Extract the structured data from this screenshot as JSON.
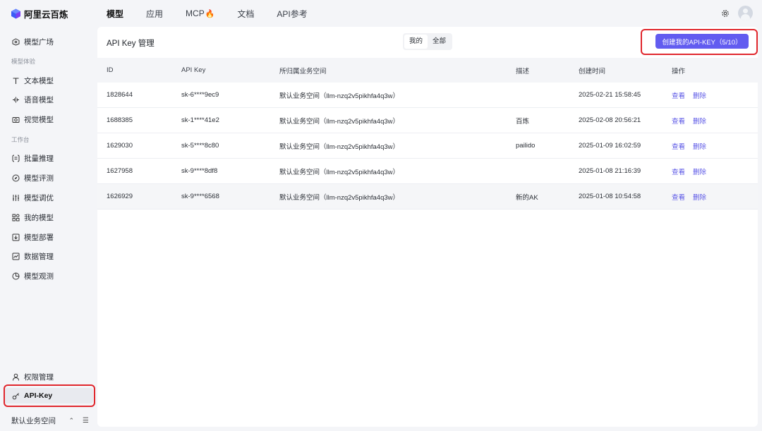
{
  "app": {
    "name": "阿里云百炼"
  },
  "topnav": [
    {
      "label": "模型",
      "active": true
    },
    {
      "label": "应用",
      "active": false
    },
    {
      "label": "MCP",
      "active": false,
      "icon": "flame-icon"
    },
    {
      "label": "文档",
      "active": false
    },
    {
      "label": "API参考",
      "active": false
    }
  ],
  "sidebar": {
    "top_item": {
      "label": "模型广场",
      "icon": "cloud-icon"
    },
    "section_experience": "模型体验",
    "experience_items": [
      {
        "label": "文本模型",
        "icon": "text-icon"
      },
      {
        "label": "语音模型",
        "icon": "waveform-icon"
      },
      {
        "label": "视觉模型",
        "icon": "camera-icon"
      }
    ],
    "section_workbench": "工作台",
    "workbench_items": [
      {
        "label": "批量推理",
        "icon": "batch-icon"
      },
      {
        "label": "模型评测",
        "icon": "compass-icon"
      },
      {
        "label": "模型调优",
        "icon": "sliders-icon"
      },
      {
        "label": "我的模型",
        "icon": "grid-icon"
      },
      {
        "label": "模型部署",
        "icon": "deploy-icon"
      },
      {
        "label": "数据管理",
        "icon": "chart-icon"
      },
      {
        "label": "模型观测",
        "icon": "pie-icon"
      }
    ],
    "bottom_items": [
      {
        "label": "权限管理",
        "icon": "user-icon",
        "active": false
      },
      {
        "label": "API-Key",
        "icon": "key-icon",
        "active": true
      }
    ],
    "workspace": {
      "label": "默认业务空间"
    }
  },
  "main": {
    "title": "API Key 管理",
    "filter": {
      "options": [
        "我的",
        "全部"
      ],
      "selected": "我的"
    },
    "create_button": "创建我的API-KEY（5/10）",
    "columns": {
      "id": "ID",
      "key": "API Key",
      "workspace": "所归属业务空间",
      "desc": "描述",
      "time": "创建时间",
      "ops": "操作"
    },
    "rows": [
      {
        "id": "1828644",
        "key": "sk-6****9ec9",
        "workspace": "默认业务空间（llm-nzq2v5pikhfa4q3w）",
        "desc": "",
        "time": "2025-02-21 15:58:45",
        "view": "查看",
        "delete": "删除"
      },
      {
        "id": "1688385",
        "key": "sk-1****41e2",
        "workspace": "默认业务空间（llm-nzq2v5pikhfa4q3w）",
        "desc": "百炼",
        "time": "2025-02-08 20:56:21",
        "view": "查看",
        "delete": "删除"
      },
      {
        "id": "1629030",
        "key": "sk-5****8c80",
        "workspace": "默认业务空间（llm-nzq2v5pikhfa4q3w）",
        "desc": "pailido",
        "time": "2025-01-09 16:02:59",
        "view": "查看",
        "delete": "删除"
      },
      {
        "id": "1627958",
        "key": "sk-9****8df8",
        "workspace": "默认业务空间（llm-nzq2v5pikhfa4q3w）",
        "desc": "",
        "time": "2025-01-08 21:16:39",
        "view": "查看",
        "delete": "删除"
      },
      {
        "id": "1626929",
        "key": "sk-9****6568",
        "workspace": "默认业务空间（llm-nzq2v5pikhfa4q3w）",
        "desc": "新的AK",
        "time": "2025-01-08 10:54:58",
        "view": "查看",
        "delete": "删除"
      }
    ]
  },
  "colors": {
    "accent": "#625cf0",
    "link": "#5b57e6",
    "highlight": "#e0272d"
  }
}
